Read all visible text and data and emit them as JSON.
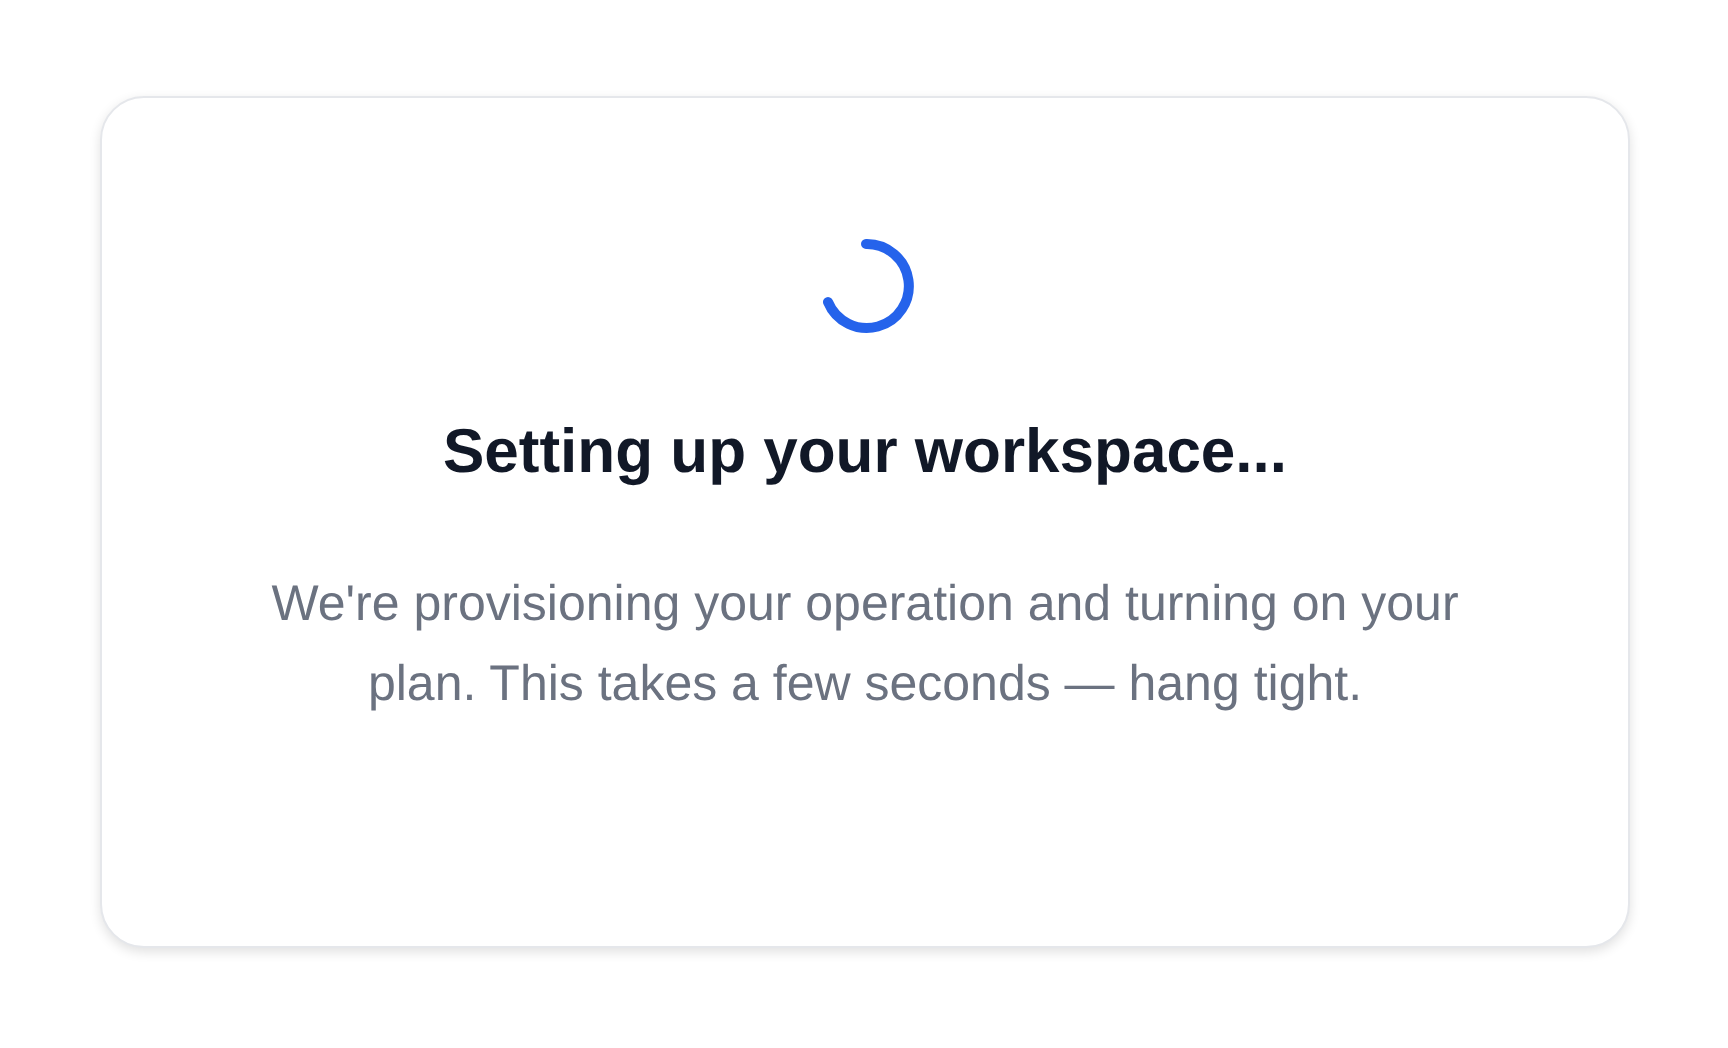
{
  "card": {
    "title": "Setting up your workspace...",
    "message": "We're provisioning your operation and turning on your plan. This takes a few seconds — hang tight."
  }
}
